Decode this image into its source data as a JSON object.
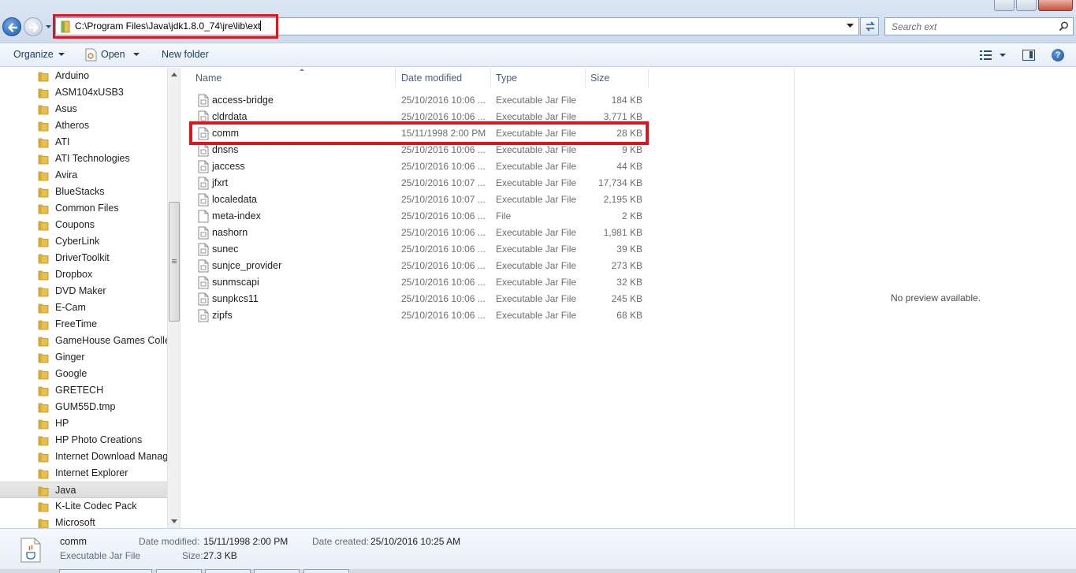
{
  "window": {
    "controls": [
      "minimize",
      "maximize",
      "close"
    ]
  },
  "addressbar": {
    "path": "C:\\Program Files\\Java\\jdk1.8.0_74\\jre\\lib\\ext",
    "search_placeholder": "Search ext"
  },
  "toolbar": {
    "organize_label": "Organize",
    "open_label": "Open",
    "new_folder_label": "New folder"
  },
  "nav_tree": {
    "items": [
      {
        "label": "Arduino",
        "selected": false
      },
      {
        "label": "ASM104xUSB3",
        "selected": false
      },
      {
        "label": "Asus",
        "selected": false
      },
      {
        "label": "Atheros",
        "selected": false
      },
      {
        "label": "ATI",
        "selected": false
      },
      {
        "label": "ATI Technologies",
        "selected": false
      },
      {
        "label": "Avira",
        "selected": false
      },
      {
        "label": "BlueStacks",
        "selected": false
      },
      {
        "label": "Common Files",
        "selected": false
      },
      {
        "label": "Coupons",
        "selected": false
      },
      {
        "label": "CyberLink",
        "selected": false
      },
      {
        "label": "DriverToolkit",
        "selected": false
      },
      {
        "label": "Dropbox",
        "selected": false
      },
      {
        "label": "DVD Maker",
        "selected": false
      },
      {
        "label": "E-Cam",
        "selected": false
      },
      {
        "label": "FreeTime",
        "selected": false
      },
      {
        "label": "GameHouse Games Collec",
        "selected": false
      },
      {
        "label": "Ginger",
        "selected": false
      },
      {
        "label": "Google",
        "selected": false
      },
      {
        "label": "GRETECH",
        "selected": false
      },
      {
        "label": "GUM55D.tmp",
        "selected": false
      },
      {
        "label": "HP",
        "selected": false
      },
      {
        "label": "HP Photo Creations",
        "selected": false
      },
      {
        "label": "Internet Download Manage",
        "selected": false
      },
      {
        "label": "Internet Explorer",
        "selected": false
      },
      {
        "label": "Java",
        "selected": true
      },
      {
        "label": "K-Lite Codec Pack",
        "selected": false
      },
      {
        "label": "Microsoft",
        "selected": false
      }
    ]
  },
  "file_list": {
    "columns": {
      "name": "Name",
      "date": "Date modified",
      "type": "Type",
      "size": "Size"
    },
    "rows": [
      {
        "name": "access-bridge",
        "date": "25/10/2016 10:06 ...",
        "type": "Executable Jar File",
        "size": "184 KB",
        "icon": "jar-file-icon"
      },
      {
        "name": "cldrdata",
        "date": "25/10/2016 10:06 ...",
        "type": "Executable Jar File",
        "size": "3,771 KB",
        "icon": "jar-file-icon"
      },
      {
        "name": "comm",
        "date": "15/11/1998 2:00 PM",
        "type": "Executable Jar File",
        "size": "28 KB",
        "icon": "jar-file-icon"
      },
      {
        "name": "dnsns",
        "date": "25/10/2016 10:06 ...",
        "type": "Executable Jar File",
        "size": "9 KB",
        "icon": "jar-file-icon"
      },
      {
        "name": "jaccess",
        "date": "25/10/2016 10:06 ...",
        "type": "Executable Jar File",
        "size": "44 KB",
        "icon": "jar-file-icon"
      },
      {
        "name": "jfxrt",
        "date": "25/10/2016 10:07 ...",
        "type": "Executable Jar File",
        "size": "17,734 KB",
        "icon": "jar-file-icon"
      },
      {
        "name": "localedata",
        "date": "25/10/2016 10:07 ...",
        "type": "Executable Jar File",
        "size": "2,195 KB",
        "icon": "jar-file-icon"
      },
      {
        "name": "meta-index",
        "date": "25/10/2016 10:06 ...",
        "type": "File",
        "size": "2 KB",
        "icon": "blank-file-icon"
      },
      {
        "name": "nashorn",
        "date": "25/10/2016 10:06 ...",
        "type": "Executable Jar File",
        "size": "1,981 KB",
        "icon": "jar-file-icon"
      },
      {
        "name": "sunec",
        "date": "25/10/2016 10:06 ...",
        "type": "Executable Jar File",
        "size": "39 KB",
        "icon": "jar-file-icon"
      },
      {
        "name": "sunjce_provider",
        "date": "25/10/2016 10:06 ...",
        "type": "Executable Jar File",
        "size": "273 KB",
        "icon": "jar-file-icon"
      },
      {
        "name": "sunmscapi",
        "date": "25/10/2016 10:06 ...",
        "type": "Executable Jar File",
        "size": "32 KB",
        "icon": "jar-file-icon"
      },
      {
        "name": "sunpkcs11",
        "date": "25/10/2016 10:06 ...",
        "type": "Executable Jar File",
        "size": "245 KB",
        "icon": "jar-file-icon"
      },
      {
        "name": "zipfs",
        "date": "25/10/2016 10:06 ...",
        "type": "Executable Jar File",
        "size": "68 KB",
        "icon": "jar-file-icon"
      }
    ]
  },
  "preview": {
    "message": "No preview available."
  },
  "details": {
    "name": "comm",
    "type": "Executable Jar File",
    "date_modified_label": "Date modified:",
    "date_modified": "15/11/1998 2:00 PM",
    "date_created_label": "Date created:",
    "date_created": "25/10/2016 10:25 AM",
    "size_label": "Size:",
    "size": "27.3 KB"
  },
  "colors": {
    "highlight_red": "#e0141e",
    "chrome_blue": "#dbe6f4",
    "link_blue": "#1e395b"
  }
}
